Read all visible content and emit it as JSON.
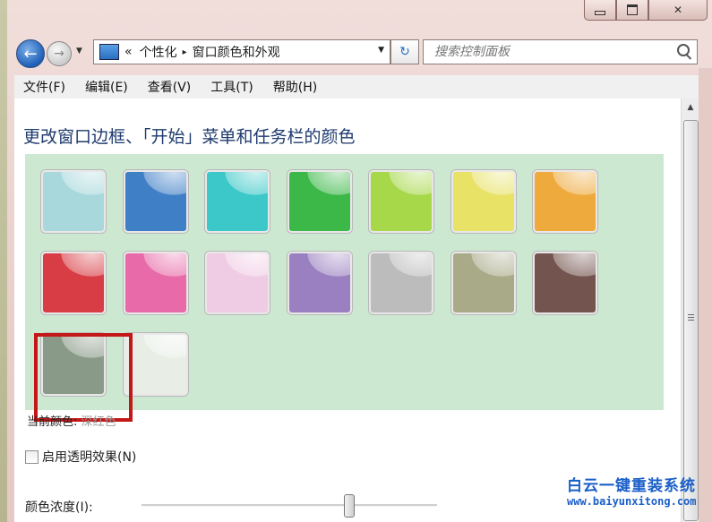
{
  "window": {
    "caption": {
      "min": "minimize-icon",
      "max": "maximize-icon",
      "close": "✕"
    }
  },
  "nav": {
    "back": "←",
    "forward": "→",
    "breadcrumb": {
      "root": "«",
      "parent": "个性化",
      "sep": "▸",
      "current": "窗口颜色和外观"
    },
    "refresh": "↻",
    "search_placeholder": "搜索控制面板"
  },
  "menu": [
    "文件(F)",
    "编辑(E)",
    "查看(V)",
    "工具(T)",
    "帮助(H)"
  ],
  "content": {
    "heading": "更改窗口边框、「开始」菜单和任务栏的颜色",
    "current_color_label": "当前颜色:",
    "current_color_value": "深红色",
    "transparency_label": "启用透明效果(N)",
    "transparency_checked": false,
    "intensity_label": "颜色浓度(I):",
    "intensity_value": 0.7
  },
  "swatches": [
    {
      "color": "#a8d8dc",
      "selected": false
    },
    {
      "color": "#3f7fc6",
      "selected": false
    },
    {
      "color": "#3cc8c8",
      "selected": false
    },
    {
      "color": "#3cb848",
      "selected": false
    },
    {
      "color": "#a6d84a",
      "selected": false
    },
    {
      "color": "#e8e266",
      "selected": false
    },
    {
      "color": "#eeaa3c",
      "selected": false
    },
    {
      "color": "#d83c44",
      "selected": true
    },
    {
      "color": "#e86aa8",
      "selected": false
    },
    {
      "color": "#f0cce4",
      "selected": false
    },
    {
      "color": "#9a80c0",
      "selected": false
    },
    {
      "color": "#bcbcbc",
      "selected": false
    },
    {
      "color": "#a8aa88",
      "selected": false
    },
    {
      "color": "#74544e",
      "selected": false
    },
    {
      "color": "#8a9a88",
      "selected": false
    },
    {
      "color": "#e8eee6",
      "selected": false
    }
  ],
  "watermark": {
    "title": "白云一键重装系统",
    "url": "www.baiyunxitong.com"
  },
  "colors": {
    "accent": "#1e3a6e",
    "selection": "#c41818",
    "panel": "#cce8d0"
  }
}
